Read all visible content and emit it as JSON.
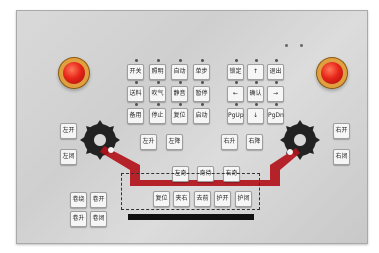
{
  "panel": {
    "top_left_block": [
      "开关",
      "照明",
      "自动",
      "单步",
      "送料",
      "吹气",
      "静音",
      "暂停",
      "备用",
      "停止",
      "复位",
      "启动"
    ],
    "nav_block": [
      "锁定",
      "↑",
      "退出",
      "←",
      "确认",
      "→",
      "PgUp",
      "↓",
      "PgDn"
    ],
    "side_keys": {
      "left": [
        "左开",
        "左闭"
      ],
      "right": [
        "右开",
        "右闭"
      ]
    },
    "mid_row_left": [
      "左升",
      "左降"
    ],
    "mid_row_right": [
      "右升",
      "右降"
    ],
    "center_row": [
      "左奇",
      "奇待",
      "右奇"
    ],
    "dashed_row": [
      "复位",
      "夹右",
      "去前",
      "护开",
      "护闭"
    ],
    "bottom_left": [
      "卷绕",
      "卷开",
      "卷升",
      "卷闭"
    ],
    "colors": {
      "estop": "#e8261a",
      "arm": "#b3121b",
      "panel": "#d3d3d3"
    }
  }
}
